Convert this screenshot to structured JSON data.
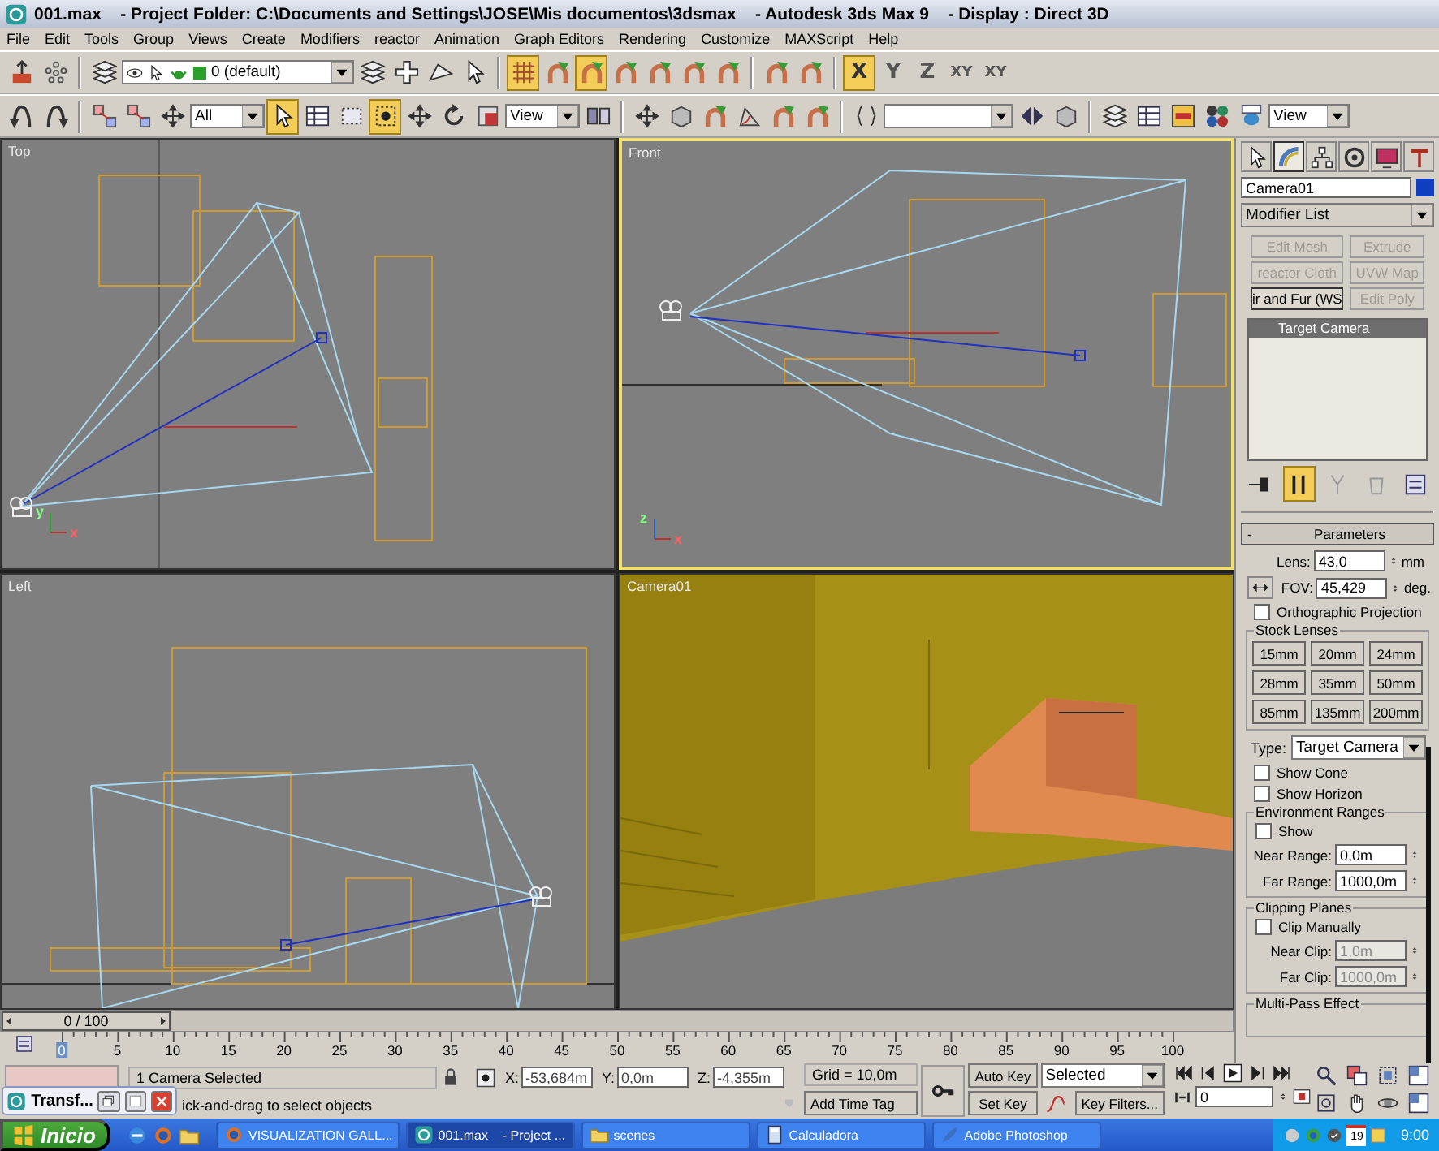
{
  "window": {
    "title": "001.max    - Project Folder: C:\\Documents and Settings\\JOSE\\Mis documentos\\3dsmax    - Autodesk 3ds Max 9    - Display : Direct 3D"
  },
  "menu": [
    "File",
    "Edit",
    "Tools",
    "Group",
    "Views",
    "Create",
    "Modifiers",
    "reactor",
    "Animation",
    "Graph Editors",
    "Rendering",
    "Customize",
    "MAXScript",
    "Help"
  ],
  "toolbar_1": {
    "layer": "0 (default)",
    "buttons": [
      {
        "pressed": false
      },
      {
        "pressed": false
      },
      {
        "pressed": false
      },
      {
        "pressed": false
      },
      {
        "pressed": false
      },
      {
        "pressed": false
      },
      {
        "pressed": false
      },
      {
        "pressed": true
      },
      {
        "pressed": false
      },
      {
        "pressed": true
      },
      {
        "pressed": false
      },
      {
        "pressed": false
      },
      {
        "pressed": false
      },
      {
        "pressed": false
      },
      {
        "pressed": false
      },
      {
        "pressed": false
      }
    ],
    "axis_constraints": [
      {
        "label": "X",
        "selected": true
      },
      {
        "label": "Y",
        "selected": false
      },
      {
        "label": "Z",
        "selected": false
      },
      {
        "label": "XY",
        "selected": false
      },
      {
        "label": "XY",
        "selected": false
      }
    ]
  },
  "toolbar_2": {
    "selection_filter": "All",
    "reference_coordinates": "View",
    "viewport_layout": "View",
    "buttons": [
      {
        "pressed": false
      },
      {
        "pressed": false
      },
      {
        "pressed": false
      },
      {
        "pressed": false
      },
      {
        "pressed": false
      },
      {
        "pressed": true
      },
      {
        "pressed": false
      },
      {
        "pressed": false
      },
      {
        "pressed": true
      },
      {
        "pressed": false
      },
      {
        "pressed": false
      },
      {
        "pressed": false
      },
      {
        "pressed": false
      },
      {
        "pressed": false
      },
      {
        "pressed": false
      },
      {
        "pressed": false
      },
      {
        "pressed": false
      },
      {
        "pressed": false
      },
      {
        "pressed": false
      },
      {
        "pressed": false
      },
      {
        "pressed": false
      },
      {
        "pressed": false
      },
      {
        "pressed": false
      },
      {
        "pressed": false
      },
      {
        "pressed": false
      },
      {
        "pressed": false
      },
      {
        "pressed": false
      }
    ]
  },
  "viewports": [
    {
      "label": "Top",
      "kind": "top",
      "active": false,
      "gizmo": [
        "y",
        "x"
      ]
    },
    {
      "label": "Front",
      "kind": "front",
      "active": true,
      "gizmo": [
        "z",
        "x"
      ]
    },
    {
      "label": "Left",
      "kind": "left",
      "active": false
    },
    {
      "label": "Camera01",
      "kind": "camera",
      "active": false
    }
  ],
  "command_panel": {
    "tabs": [
      {
        "selected": false
      },
      {
        "selected": true
      },
      {
        "selected": false
      },
      {
        "selected": false
      },
      {
        "selected": false
      },
      {
        "selected": false
      }
    ],
    "object_name": "Camera01",
    "modifier_list": "Modifier List",
    "modifier_buttons": [
      {
        "label": "Edit Mesh",
        "disabled": true
      },
      {
        "label": "Extrude",
        "disabled": true
      },
      {
        "label": "reactor Cloth",
        "disabled": true
      },
      {
        "label": "UVW Map",
        "disabled": true
      },
      {
        "label": "ir and Fur (WS",
        "disabled": false
      },
      {
        "label": "Edit Poly",
        "disabled": true
      }
    ],
    "stack": [
      {
        "label": "Target Camera",
        "selected": true
      }
    ],
    "stack_buttons": [
      {
        "pressed": false
      },
      {
        "pressed": true
      },
      {
        "pressed": false
      },
      {
        "pressed": false
      },
      {
        "pressed": false
      }
    ],
    "parameters": {
      "collapse": "-",
      "title": "Parameters",
      "lens": {
        "label": "Lens:",
        "value": "43,0",
        "unit": "mm"
      },
      "fov": {
        "label": "FOV:",
        "value": "45,429",
        "unit": "deg."
      },
      "orthographic": {
        "label": "Orthographic Projection",
        "checked": false
      },
      "stock_lenses": {
        "title": "Stock Lenses",
        "buttons": [
          "15mm",
          "20mm",
          "24mm",
          "28mm",
          "35mm",
          "50mm",
          "85mm",
          "135mm",
          "200mm"
        ]
      },
      "type": {
        "label": "Type:",
        "value": "Target Camera"
      },
      "show_cone": {
        "label": "Show Cone",
        "checked": false
      },
      "show_horizon": {
        "label": "Show Horizon",
        "checked": false
      },
      "environment_ranges": {
        "title": "Environment Ranges",
        "show": {
          "label": "Show",
          "checked": false
        },
        "fields": [
          {
            "label": "Near Range:",
            "value": "0,0m"
          },
          {
            "label": "Far Range:",
            "value": "1000,0m"
          }
        ]
      },
      "clipping_planes": {
        "title": "Clipping Planes",
        "clip": {
          "label": "Clip Manually",
          "checked": false
        },
        "fields": [
          {
            "label": "Near Clip:",
            "value": "1,0m",
            "disabled": true
          },
          {
            "label": "Far Clip:",
            "value": "1000,0m",
            "disabled": true
          }
        ]
      },
      "multi_pass": {
        "title": "Multi-Pass Effect"
      }
    }
  },
  "time_slider": {
    "label": "0 / 100",
    "level": 0
  },
  "track_bar": {
    "ticks": [
      "0",
      "5",
      "10",
      "15",
      "20",
      "25",
      "30",
      "35",
      "40",
      "45",
      "50",
      "55",
      "60",
      "65",
      "70",
      "75",
      "80",
      "85",
      "90",
      "95",
      "100"
    ]
  },
  "status": {
    "selection": "1 Camera Selected",
    "prompt": "ick-and-drag to select objects",
    "coords": [
      {
        "label": "X:",
        "value": "-53,684m"
      },
      {
        "label": "Y:",
        "value": "0,0m"
      },
      {
        "label": "Z:",
        "value": "-4,355m"
      }
    ],
    "grid": "Grid = 10,0m",
    "time_tag": "Add Time Tag",
    "auto_key": "Auto Key",
    "set_key": "Set Key",
    "key_mode": "Selected",
    "key_filters": "Key Filters...",
    "frame": "0"
  },
  "minimized_window": {
    "title": "Transf..."
  },
  "taskbar": {
    "start": "Inicio",
    "tasks": [
      {
        "label": "VISUALIZATION GALL...",
        "selected": false
      },
      {
        "label": "001.max    - Project ...",
        "selected": true
      },
      {
        "label": "scenes",
        "selected": false
      },
      {
        "label": "Calculadora",
        "selected": false
      },
      {
        "label": "Adobe Photoshop",
        "selected": false
      }
    ],
    "clock": "9:00",
    "date_icon": "19"
  }
}
